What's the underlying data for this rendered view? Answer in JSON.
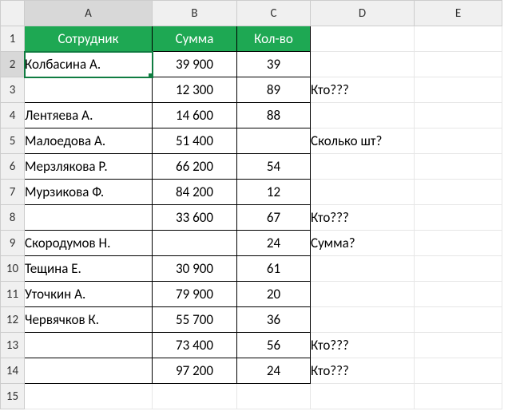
{
  "columns": [
    "A",
    "B",
    "C",
    "D",
    "E"
  ],
  "row_numbers": [
    1,
    2,
    3,
    4,
    5,
    6,
    7,
    8,
    9,
    10,
    11,
    12,
    13,
    14,
    15
  ],
  "headers": {
    "a": "Сотрудник",
    "b": "Сумма",
    "c": "Кол-во"
  },
  "rows": [
    {
      "a": "Колбасина А.",
      "b": "39 900",
      "c": "39",
      "d": ""
    },
    {
      "a": "",
      "b": "12 300",
      "c": "89",
      "d": "Кто???"
    },
    {
      "a": "Лентяева А.",
      "b": "14 600",
      "c": "88",
      "d": ""
    },
    {
      "a": "Малоедова А.",
      "b": "51 400",
      "c": "",
      "d": "Сколько шт?"
    },
    {
      "a": "Мерзлякова Р.",
      "b": "66 200",
      "c": "54",
      "d": ""
    },
    {
      "a": "Мурзикова Ф.",
      "b": "84 200",
      "c": "12",
      "d": ""
    },
    {
      "a": "",
      "b": "33 600",
      "c": "67",
      "d": "Кто???"
    },
    {
      "a": "Скородумов Н.",
      "b": "",
      "c": "24",
      "d": "Сумма?"
    },
    {
      "a": "Тещина Е.",
      "b": "30 900",
      "c": "61",
      "d": ""
    },
    {
      "a": "Уточкин А.",
      "b": "79 900",
      "c": "20",
      "d": ""
    },
    {
      "a": "Червячков К.",
      "b": "55 700",
      "c": "36",
      "d": ""
    },
    {
      "a": "",
      "b": "73 400",
      "c": "56",
      "d": "Кто???"
    },
    {
      "a": "",
      "b": "97 200",
      "c": "24",
      "d": "Кто???"
    }
  ],
  "active_cell": "A2",
  "colors": {
    "header_fill": "#1ea853",
    "selection": "#107c41"
  }
}
